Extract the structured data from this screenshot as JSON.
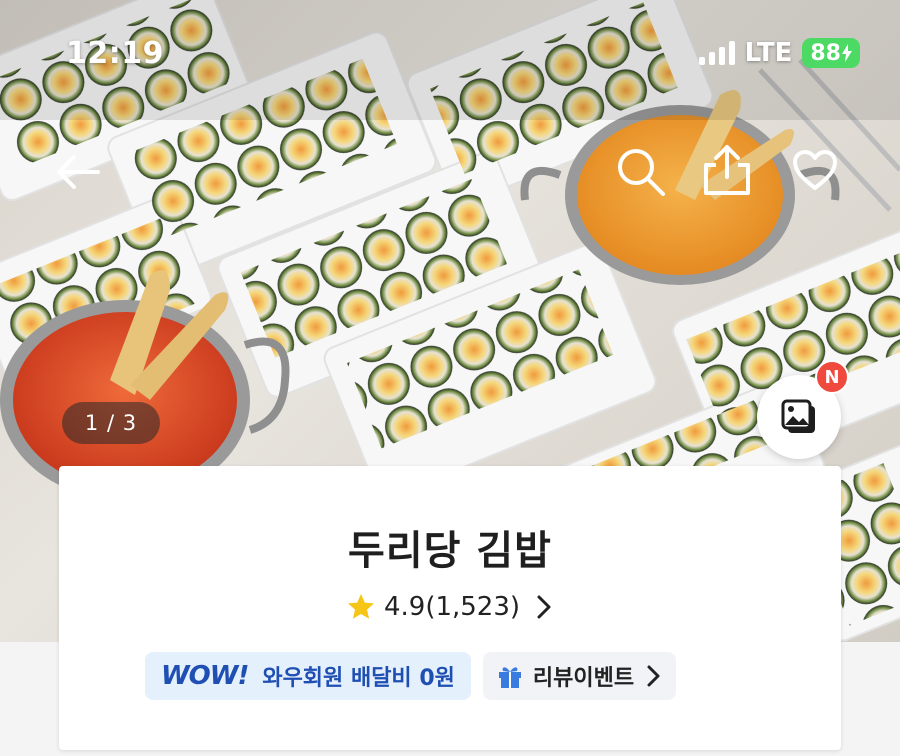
{
  "status_bar": {
    "time": "12:19",
    "network": "LTE",
    "battery": "88"
  },
  "header": {
    "back_icon": "arrow-left-icon",
    "search_icon": "search-icon",
    "share_icon": "share-icon",
    "favorite_icon": "heart-icon"
  },
  "gallery": {
    "counter": "1 / 3",
    "photo_review_icon": "photo-gallery-icon",
    "new_badge": "N"
  },
  "store": {
    "name": "두리당 김밥",
    "rating": "4.9",
    "review_count": "(1,523)",
    "star_color": "#f5c518"
  },
  "chips": {
    "wow_logo": "WOW!",
    "wow_text": "와우회원 배달비 0원",
    "event_icon": "gift-icon",
    "event_text": "리뷰이벤트"
  },
  "colors": {
    "accent": "#1f4fb3",
    "badge": "#ef4a3d",
    "battery": "#4cd964"
  }
}
